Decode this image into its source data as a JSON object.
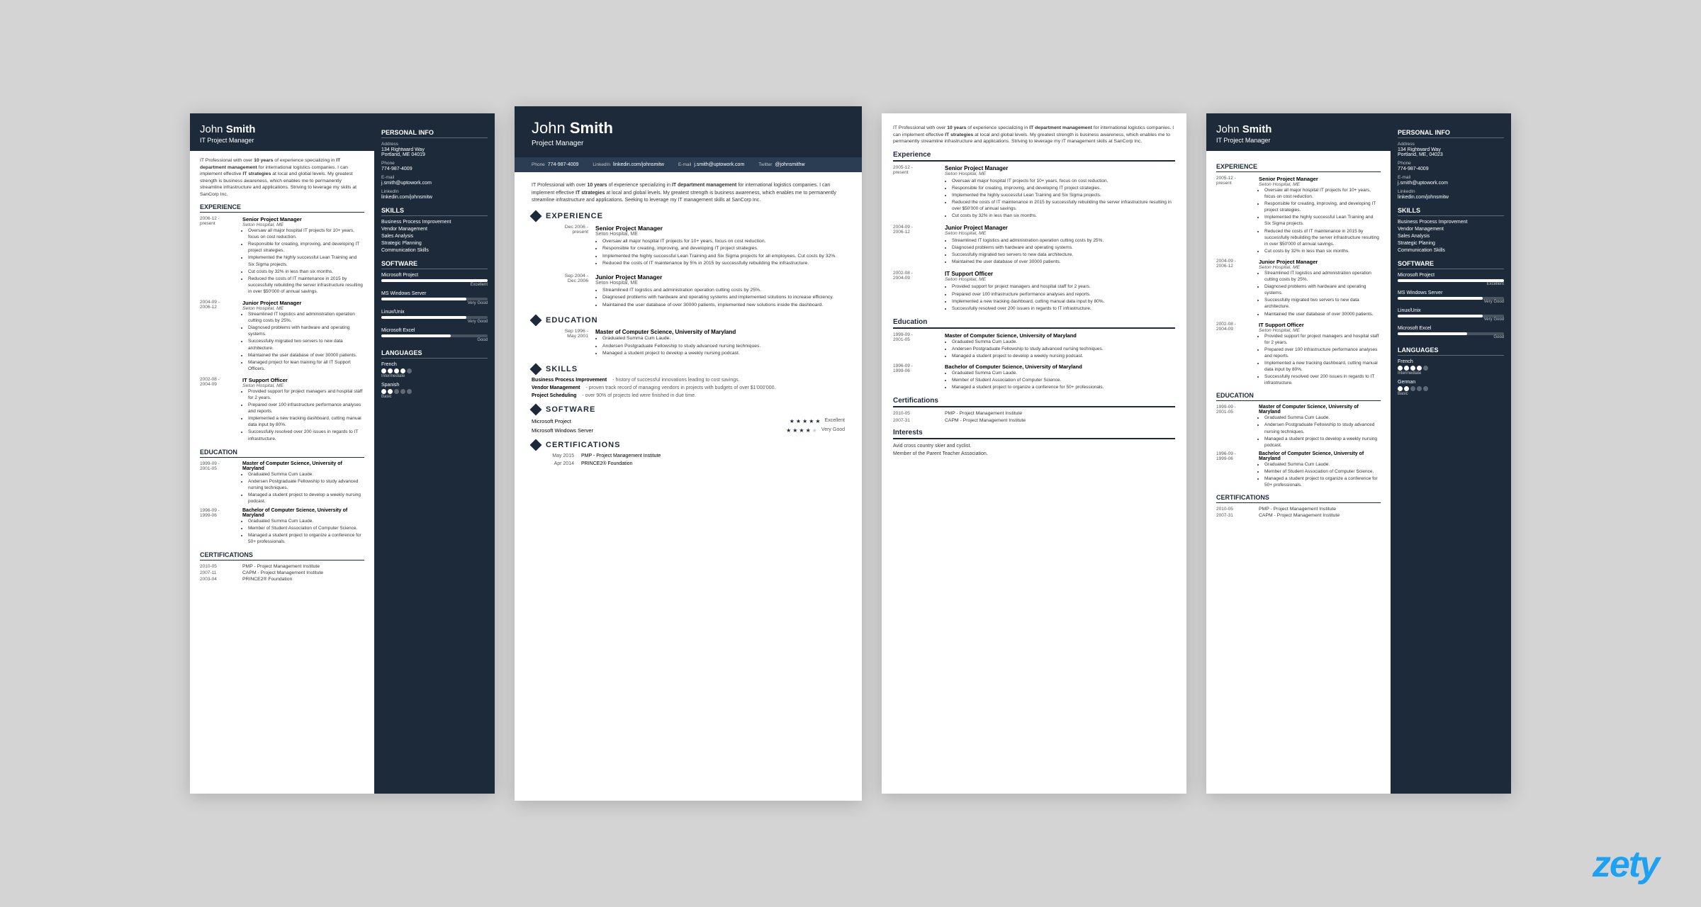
{
  "brand": "zety",
  "resumes": [
    {
      "id": "resume1",
      "name_first": "John",
      "name_last": "Smith",
      "title": "IT Project Manager",
      "summary": "IT Professional with over 10 years of experience specializing in IT department management for international logistics companies. I can implement effective IT strategies at local and global levels. My greatest strength is business awareness, which enables me to permanently streamline infrastructure and applications. Striving to leverage my skills at SanCorp Inc.",
      "experience": [
        {
          "dates": "2006-12 - present",
          "title": "Senior Project Manager",
          "company": "Seton Hospital, ME",
          "bullets": [
            "Oversaw all major hospital IT projects for 10+ years, focus on cost reduction.",
            "Responsible for creating, improving, and developing IT project strategies.",
            "Implemented the highly successful Lean Training and Six Sigma projects.",
            "Cut costs by 32% in less than six months.",
            "Reduced the costs of IT maintenance in 2015 by successfully rebuilding the server infrastructure resulting in over $50'000 of annual savings."
          ]
        },
        {
          "dates": "2004-09 - 2006-12",
          "title": "Junior Project Manager",
          "company": "Seton Hospital, ME",
          "bullets": [
            "Streamlined IT logistics and administration operation cutting costs by 25%.",
            "Diagnosed problems with hardware and operating systems.",
            "Successfully migrated two servers to new data architecture.",
            "Maintained the user database of over 30000 patients.",
            "Managed project for lean training for all IT Support Officers."
          ]
        },
        {
          "dates": "2002-08 - 2004-09",
          "title": "IT Support Officer",
          "company": "Seton Hospital, ME",
          "bullets": [
            "Provided support for project managers and hospital staff for 2 years.",
            "Prepared over 100 infrastructure performance analyses and reports.",
            "Implemented a new tracking dashboard, cutting manual data input by 80%.",
            "Successfully resolved over 200 issues in regards to IT infrastructure."
          ]
        }
      ],
      "education": [
        {
          "dates": "1999-09 - 2001-05",
          "degree": "Master of Computer Science, University of Maryland",
          "bullets": [
            "Graduated Summa Cum Laude.",
            "Andersen Postgraduate Fellowship to study advanced nursing techniques.",
            "Managed a student project to develop a weekly nursing podcast."
          ]
        },
        {
          "dates": "1996-09 - 1999-06",
          "degree": "Bachelor of Computer Science, University of Maryland",
          "bullets": [
            "Graduated Summa Cum Laude.",
            "Member of Student Association of Computer Science.",
            "Managed a student project to organize a conference for 50+ professionals."
          ]
        }
      ],
      "certifications": [
        {
          "dates": "2010-05",
          "name": "PMP - Project Management Institute"
        },
        {
          "dates": "2007-11",
          "name": "CAPM - Project Management Institute"
        },
        {
          "dates": "2003-04",
          "name": "PRINCE2® Foundation"
        }
      ],
      "sidebar": {
        "personal_info": {
          "address": "134 Rightward Way\nPortland, ME 04019",
          "phone": "774-987-4009",
          "email": "j.smith@uptowork.com",
          "linkedin": "linkedin.com/johnsmitw"
        },
        "skills": [
          "Business Process Improvement",
          "Vendor Management",
          "Sales Analysis",
          "Strategic Planning",
          "Communication Skills"
        ],
        "software": [
          {
            "name": "Microsoft Project",
            "pct": 100,
            "label": "Excellent"
          },
          {
            "name": "MS Windows Server",
            "pct": 80,
            "label": "Very Good"
          },
          {
            "name": "Linux/Unix",
            "pct": 80,
            "label": "Very Good"
          },
          {
            "name": "Microsoft Excel",
            "pct": 65,
            "label": "Good"
          }
        ],
        "languages": [
          {
            "name": "French",
            "dots": 4,
            "label": "Intermediate"
          },
          {
            "name": "Spanish",
            "dots": 2,
            "label": "Basic"
          }
        ]
      }
    },
    {
      "id": "resume2",
      "name_first": "John",
      "name_last": "Smith",
      "title": "Project Manager",
      "phone": "774-987-4009",
      "email": "j.smith@uptowork.com",
      "linkedin": "linkedin.com/johnsmitw",
      "twitter": "@johnsmithw",
      "summary": "IT Professional with over 10 years of experience specializing in IT department management for international logistics companies. I can implement effective IT strategies at local and global levels. My greatest strength is business awareness, which enables me to permanently streamline infrastructure and applications. Seeking to leverage my IT management skills at SanCorp Inc.",
      "experience": [
        {
          "dates": "Dec 2006 - present",
          "title": "Senior Project Manager",
          "company": "Seton Hospital, ME",
          "bullets": [
            "Oversaw all major hospital IT projects for 10+ years, focus on cost reduction.",
            "Responsible for creating, improving, and developing IT project strategies.",
            "Implemented the highly successful Lean Training and Six Sigma projects for all employees. Cut costs by 32%.",
            "Reduced the costs of IT maintenance by 5% in 2015 by successfully rebuilding the infrastructure."
          ]
        },
        {
          "dates": "Sep 2004 - Dec 2006",
          "title": "Junior Project Manager",
          "company": "Seton Hospital, ME",
          "bullets": [
            "Streamlined IT logistics and administration operation cutting costs by 25%.",
            "Diagnosed problems with hardware and operating systems and implemented solutions to increase efficiency.",
            "Maintained the user database of over 30000 patients, implemented new solutions inside the dashboard."
          ]
        }
      ],
      "education": [
        {
          "dates": "Sep 1996 - May 2001",
          "degree": "Master of Computer Science, University of Maryland",
          "bullets": [
            "Graduated Summa Cum Laude.",
            "Andersen Postgraduate Fellowship to study advanced nursing techniques.",
            "Managed a student project to develop a weekly nursing podcast."
          ]
        }
      ],
      "skills": [
        {
          "name": "Business Process Improvement",
          "desc": "- history of successful innovations leading to cost savings."
        },
        {
          "name": "Vendor Management",
          "desc": "- proven track record of managing vendors in projects with budgets of over $1'000'000."
        },
        {
          "name": "Project Scheduling",
          "desc": "- over 90% of projects led were finished in due time."
        }
      ],
      "software": [
        {
          "name": "Microsoft Project",
          "stars": 5,
          "label": "Excellent"
        },
        {
          "name": "Microsoft Windows Server",
          "stars": 4,
          "label": "Very Good"
        }
      ],
      "certifications": [
        {
          "date": "May 2015",
          "name": "PMP - Project Management Institute"
        },
        {
          "date": "Apr 2014",
          "name": "PRINCE2® Foundation"
        }
      ]
    },
    {
      "id": "resume3",
      "summary": "IT Professional with over 10 years of experience specializing in IT department management for international logistics companies. I can implement effective IT strategies at local and global levels. My greatest strength is business awareness, which enables me to permanently streamline infrastructure and applications. Striving to leverage my IT management skills at SanCorp Inc.",
      "experience": [
        {
          "dates": "2005-12 - present",
          "title": "Senior Project Manager",
          "company": "Seton Hospital, ME",
          "bullets": [
            "Oversaw all major hospital IT projects for 10+ years, focus on cost reduction.",
            "Responsible for creating, improving, and developing IT project strategies.",
            "Implemented the highly successful Lean Training and Six Sigma projects.",
            "Reduced the costs of IT maintenance in 2015 by successfully rebuilding the server infrastructure resulting in over $50'000 of annual savings.",
            "Cut costs by 32% in less than six months."
          ]
        },
        {
          "dates": "2004-09 - 2006-12",
          "title": "Junior Project Manager",
          "company": "Seton Hospital, ME",
          "bullets": [
            "Streamlined IT logistics and administration operation cutting costs by 25%.",
            "Diagnosed problems with hardware and operating systems.",
            "Successfully migrated two servers to new data architecture.",
            "Maintained the user database of over 30000 patients."
          ]
        },
        {
          "dates": "2002-08 - 2004-09",
          "title": "IT Support Officer",
          "company": "Seton Hospital, ME",
          "bullets": [
            "Provided support for project managers and hospital staff for 2 years.",
            "Prepared over 100 infrastructure performance analyses and reports.",
            "Implemented a new tracking dashboard, cutting manual data input by 80%.",
            "Successfully resolved over 200 issues in regards to IT infrastructure."
          ]
        }
      ],
      "education": [
        {
          "dates": "1999-09 - 2001-05",
          "degree": "Master of Computer Science, University of Maryland",
          "bullets": [
            "Graduated Summa Cum Laude.",
            "Andersen Postgraduate Fellowship to study advanced nursing techniques.",
            "Managed a student project to develop a weekly nursing podcast."
          ]
        },
        {
          "dates": "1996-09 - 1999-06",
          "degree": "Bachelor of Computer Science, University of Maryland",
          "bullets": [
            "Graduated Summa Cum Laude.",
            "Member of Student Association of Computer Science.",
            "Managed a student project to organize a conference for 50+ professionals."
          ]
        }
      ],
      "certifications": [
        {
          "dates": "2010-05",
          "name": "PMP - Project Management Institute"
        },
        {
          "dates": "2007-31",
          "name": "CAPM - Project Management Institute"
        }
      ],
      "interests": "Avid cross country skier and cyclist.\nMember of the Parent Teacher Association."
    },
    {
      "id": "resume4",
      "name_first": "John",
      "name_last": "Smith",
      "title": "IT Project Manager",
      "sidebar": {
        "personal_info": {
          "address": "134 Rightward Way\nPortland, ME, 04023",
          "phone": "774-987-4009",
          "email": "j.smith@uptowork.com",
          "linkedin": "linkedin.com/johnsmitw"
        },
        "skills": [
          "Business Process Improvement",
          "Vendor Management",
          "Sales Analysis",
          "Strategic Planing",
          "Communication Skills"
        ],
        "software": [
          {
            "name": "Microsoft Project",
            "pct": 100,
            "label": "Excellent"
          },
          {
            "name": "MS Windows Server",
            "pct": 80,
            "label": "Very Good"
          },
          {
            "name": "Linux/Unix",
            "pct": 80,
            "label": "Very Good"
          },
          {
            "name": "Microsoft Excel",
            "pct": 65,
            "label": "Good"
          }
        ],
        "languages": [
          {
            "name": "French",
            "dots": 4,
            "label": "Intermediate"
          },
          {
            "name": "German",
            "dots": 2,
            "label": "Basic"
          }
        ]
      }
    }
  ]
}
